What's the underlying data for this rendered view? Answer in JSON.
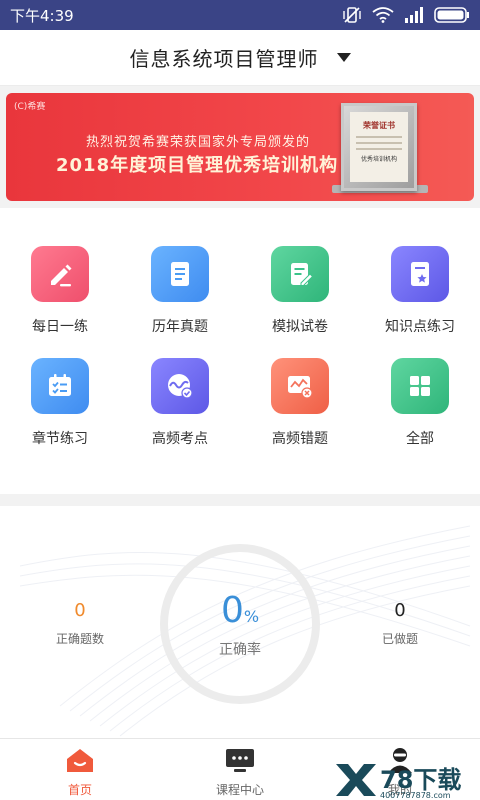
{
  "status_bar": {
    "time": "下午4:39"
  },
  "header": {
    "title": "信息系统项目管理师"
  },
  "banner": {
    "brand": "希赛",
    "line1": "热烈祝贺希赛荣获国家外专局颁发的",
    "line2": "2018年度项目管理优秀培训机构",
    "certificate_title": "荣誉证书",
    "certificate_sub": "优秀培训机构"
  },
  "grid": {
    "items": [
      {
        "label": "每日一练",
        "icon": "pencil-icon",
        "color": "#f4607a"
      },
      {
        "label": "历年真题",
        "icon": "document-icon",
        "color": "#4a9cf4"
      },
      {
        "label": "模拟试卷",
        "icon": "exam-paper-icon",
        "color": "#3cc38a"
      },
      {
        "label": "知识点练习",
        "icon": "bookmark-star-icon",
        "color": "#6f6cf0"
      },
      {
        "label": "章节练习",
        "icon": "checklist-icon",
        "color": "#4a9cf4"
      },
      {
        "label": "高频考点",
        "icon": "wave-badge-icon",
        "color": "#6f6cf0"
      },
      {
        "label": "高频错题",
        "icon": "error-chart-icon",
        "color": "#f4735c"
      },
      {
        "label": "全部",
        "icon": "grid-apps-icon",
        "color": "#3cc38a"
      }
    ]
  },
  "stats": {
    "correct_count": "0",
    "correct_count_label": "正确题数",
    "accuracy_value": "0",
    "accuracy_unit": "%",
    "accuracy_label": "正确率",
    "done_count": "0",
    "done_count_label": "已做题",
    "correct_color": "#f08a2c",
    "accuracy_color": "#3a8fd8"
  },
  "tabbar": {
    "tabs": [
      {
        "label": "首页",
        "icon": "home-icon",
        "active": true
      },
      {
        "label": "课程中心",
        "icon": "course-center-icon",
        "active": false
      },
      {
        "label": "我的",
        "icon": "profile-icon",
        "active": false
      }
    ]
  },
  "watermark": {
    "big": "78下载",
    "url": "4007787878.com"
  },
  "colors": {
    "statusbar": "#3a4486",
    "accent": "#f05a3c",
    "banner": "#ee3d40"
  }
}
